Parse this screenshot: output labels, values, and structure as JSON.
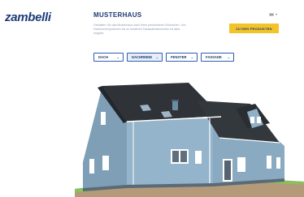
{
  "brand": {
    "logo_text": "zambelli"
  },
  "header": {
    "title": "MUSTERHAUS",
    "description": "Gestalten Sie das Musterhaus nach Ihren persönlichen Wünschen. Von Dachrinnensystemen bis zu kreativen Fassadenelementen ist alles möglich.",
    "cta_label": "ZU DEN PRODUKTEN",
    "language": "DE"
  },
  "filters": [
    {
      "label": "DACH",
      "active": false
    },
    {
      "label": "DACHRINNE",
      "active": true
    },
    {
      "label": "FENSTER",
      "active": false
    },
    {
      "label": "FASSADE",
      "active": false
    }
  ],
  "colors": {
    "brand_blue": "#1b3a6f",
    "accent_yellow": "#f2c42a",
    "house_wall": "#8fb0c6",
    "roof": "#2f3338",
    "grass": "#6da548"
  },
  "icons": {
    "dropdown_caret": "chevron-down-icon",
    "flag": "flag-icon"
  }
}
